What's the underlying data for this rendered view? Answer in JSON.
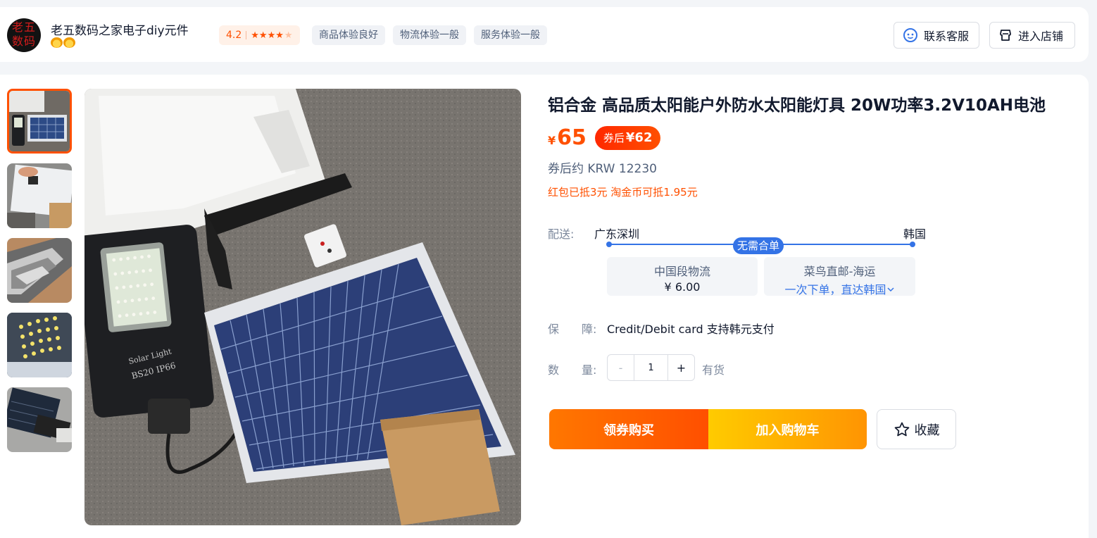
{
  "shop": {
    "avatar_text": "老五数码",
    "name": "老五数码之家电子diy元件",
    "rating": "4.2",
    "stars_icon": "star-rating-icon",
    "tags": [
      "商品体验良好",
      "物流体验一般",
      "服务体验一般"
    ],
    "contact_label": "联系客服",
    "enter_store_label": "进入店铺"
  },
  "product": {
    "title": "铝合金 高品质太阳能户外防水太阳能灯具 20W功率3.2V10AH电池",
    "currency_symbol": "¥",
    "price": "65",
    "coupon_label": "券后",
    "coupon_price": "¥62",
    "krw_text": "券后约 KRW 12230",
    "promo_text": "红包已抵3元 淘金币可抵1.95元"
  },
  "shipping": {
    "label": "配送:",
    "from": "广东深圳",
    "to": "韩国",
    "badge": "无需合单",
    "domestic": {
      "title": "中国段物流",
      "price": "¥ 6.00"
    },
    "intl": {
      "title": "菜鸟直邮-海运",
      "desc": "一次下单，直达韩国"
    }
  },
  "guarantee": {
    "label": "保　　障:",
    "text": "Credit/Debit card 支持韩元支付"
  },
  "quantity": {
    "label": "数　　量:",
    "minus": "-",
    "value": "1",
    "plus": "+",
    "stock": "有货"
  },
  "actions": {
    "buy": "领券购买",
    "cart": "加入购物车",
    "favorite": "收藏"
  },
  "photo_texts": {
    "label1": "Solar Light",
    "label2": "BS20  IP66"
  },
  "colors": {
    "accent": "#ff5000",
    "blue": "#3473e6"
  }
}
